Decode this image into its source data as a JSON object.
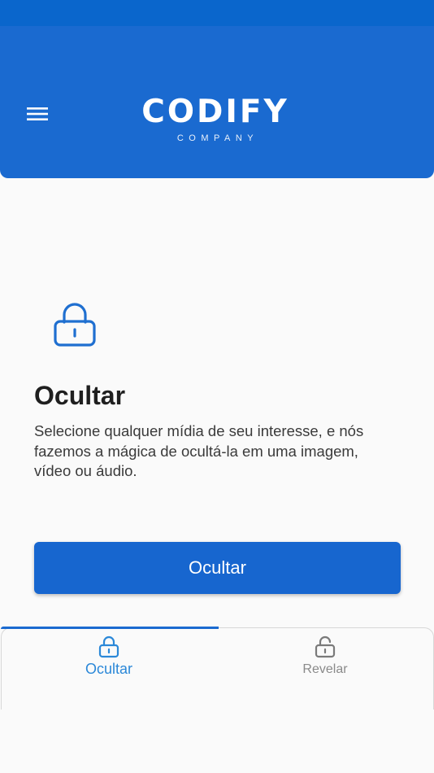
{
  "header": {
    "logo_main": "CODIFY",
    "logo_sub": "COMPANY",
    "menu_icon": "hamburger-menu-icon"
  },
  "main": {
    "icon": "lock-icon",
    "title": "Ocultar",
    "description": "Selecione qualquer mídia de seu interesse, e nós fazemos a mágica de ocultá-la em uma imagem, vídeo ou áudio.",
    "button_label": "Ocultar"
  },
  "bottom_nav": {
    "active_tab": "Ocultar",
    "tabs": [
      {
        "label": "Ocultar",
        "icon": "lock-closed-icon",
        "active": true
      },
      {
        "label": "Revelar",
        "icon": "lock-open-icon",
        "active": false
      }
    ]
  },
  "colors": {
    "primary": "#1a6ad0",
    "status_bar": "#0a66cc",
    "active_tab": "#2b88d8",
    "inactive_tab": "#8a8a8a",
    "background": "#fafafa"
  }
}
